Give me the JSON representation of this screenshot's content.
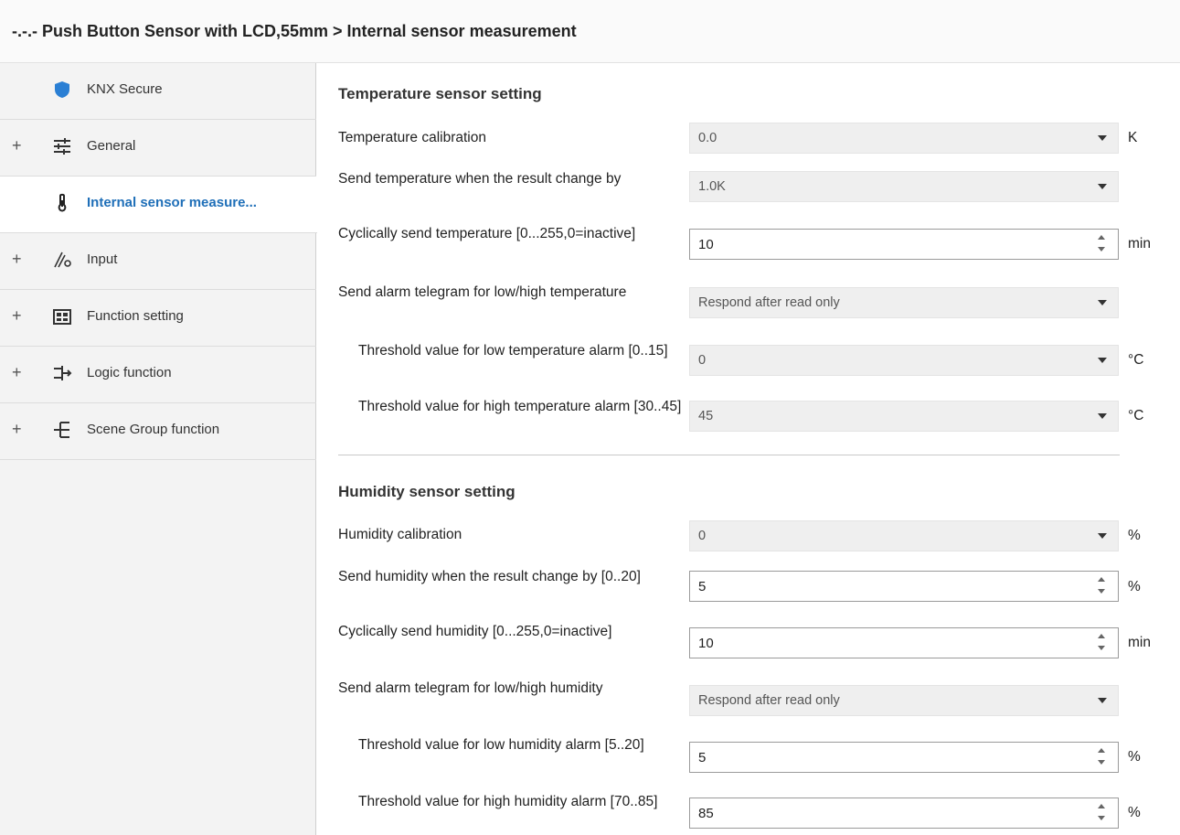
{
  "window": {
    "title": "-.-.- Push Button Sensor with LCD,55mm > Internal sensor measurement"
  },
  "sidebar": {
    "items": [
      {
        "label": "KNX Secure",
        "icon": "shield-icon",
        "expandable": false,
        "active": false
      },
      {
        "label": "General",
        "icon": "sliders-icon",
        "expandable": true,
        "active": false
      },
      {
        "label": "Internal sensor measure...",
        "icon": "thermometer-icon",
        "expandable": false,
        "active": true
      },
      {
        "label": "Input",
        "icon": "input-icon",
        "expandable": true,
        "active": false
      },
      {
        "label": "Function setting",
        "icon": "grid-icon",
        "expandable": true,
        "active": false
      },
      {
        "label": "Logic function",
        "icon": "logic-icon",
        "expandable": true,
        "active": false
      },
      {
        "label": "Scene Group function",
        "icon": "scene-icon",
        "expandable": true,
        "active": false
      }
    ],
    "expand_symbol": "+"
  },
  "temperature": {
    "heading": "Temperature sensor setting",
    "calibration": {
      "label": "Temperature calibration",
      "value": "0.0",
      "unit": "K"
    },
    "send_change": {
      "label": "Send temperature when the result change by",
      "value": "1.0K"
    },
    "cyclic": {
      "label": "Cyclically send temperature [0...255,0=inactive]",
      "value": "10",
      "unit": "min"
    },
    "alarm": {
      "label": "Send alarm telegram for low/high temperature",
      "value": "Respond after read only"
    },
    "low_threshold": {
      "label": "Threshold value for low temperature alarm [0..15]",
      "value": "0",
      "unit": "°C"
    },
    "high_threshold": {
      "label": "Threshold value for high temperature alarm [30..45]",
      "value": "45",
      "unit": "°C"
    }
  },
  "humidity": {
    "heading": "Humidity sensor setting",
    "calibration": {
      "label": "Humidity calibration",
      "value": "0",
      "unit": "%"
    },
    "send_change": {
      "label": "Send humidity when the result change by [0..20]",
      "value": "5",
      "unit": "%"
    },
    "cyclic": {
      "label": "Cyclically send humidity [0...255,0=inactive]",
      "value": "10",
      "unit": "min"
    },
    "alarm": {
      "label": "Send alarm telegram for low/high humidity",
      "value": "Respond after read only"
    },
    "low_threshold": {
      "label": "Threshold value for low humidity alarm [5..20]",
      "value": "5",
      "unit": "%"
    },
    "high_threshold": {
      "label": "Threshold value for high humidity alarm [70..85]",
      "value": "85",
      "unit": "%"
    }
  },
  "colors": {
    "accent": "#1f6fb8",
    "shield": "#2a7fd4"
  }
}
